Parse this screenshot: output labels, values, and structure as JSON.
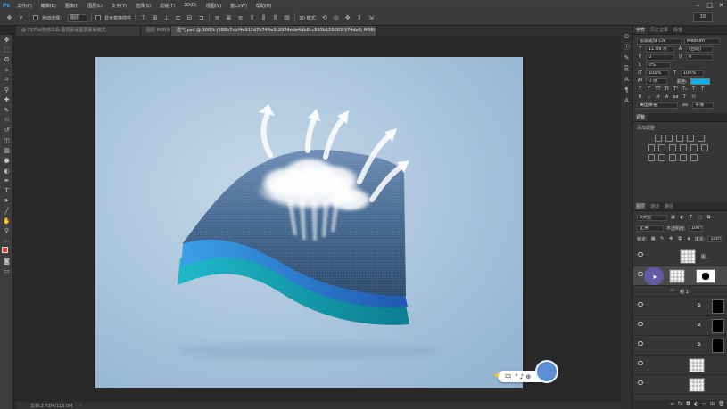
{
  "app": {
    "logo": "Ps",
    "accent": "#31a8ff"
  },
  "menu": [
    "文件(F)",
    "编辑(E)",
    "图像(I)",
    "图层(L)",
    "文字(Y)",
    "选择(S)",
    "滤镜(T)",
    "3D(D)",
    "视图(V)",
    "窗口(W)",
    "帮助(H)"
  ],
  "options": {
    "auto_select_label": "自动选择：",
    "auto_select_value": "图层",
    "show_transform_label": "显示变换控件",
    "workspace": "3D"
  },
  "tabs": [
    {
      "label": "@ 317%(使用工具:图层蒙版图层蒙版模式"
    },
    {
      "label": "图层 RGB/8 *"
    },
    {
      "label": "透气.psd @ 100% (588b7cbf4e912d7b746a3c2924ede4db8cc893b120663-174de6, RGB/8#) *"
    }
  ],
  "status": {
    "doc": "文档:2.72M/118.0M"
  },
  "ime": {
    "lang": "中",
    "symbols": "° ♪ ⊕"
  },
  "panel_top": {
    "tabs": [
      "字符",
      "历史记录",
      "段落"
    ],
    "font_family": "思源黑体 CN",
    "font_style": "Medium",
    "font_size": "11.09 点",
    "leading": "(自动)",
    "kerning": "0",
    "tracking": "0",
    "baseline": "0%",
    "scale_v": "100%",
    "scale_h": "100%",
    "shift": "0 点",
    "color_label": "颜色:",
    "color": "#00b4f0",
    "lang": "美国英语",
    "aa": "平滑",
    "aa2": "aa"
  },
  "adjust": {
    "title": "调整",
    "subtitle": "添加调整"
  },
  "layers_panel": {
    "tabs": [
      "图层",
      "通道",
      "路径"
    ],
    "filter": "ρ类型",
    "blend": "正常",
    "opacity_label": "不透明度:",
    "opacity": "100%",
    "lock_label": "锁定:",
    "fill_label": "填充:",
    "fill": "100%",
    "layers": [
      {
        "name": "图..."
      },
      {
        "name": ""
      },
      {
        "name": "组 1"
      },
      {
        "name": ""
      },
      {
        "name": ""
      },
      {
        "name": ""
      },
      {
        "name": ""
      },
      {
        "name": ""
      }
    ]
  }
}
